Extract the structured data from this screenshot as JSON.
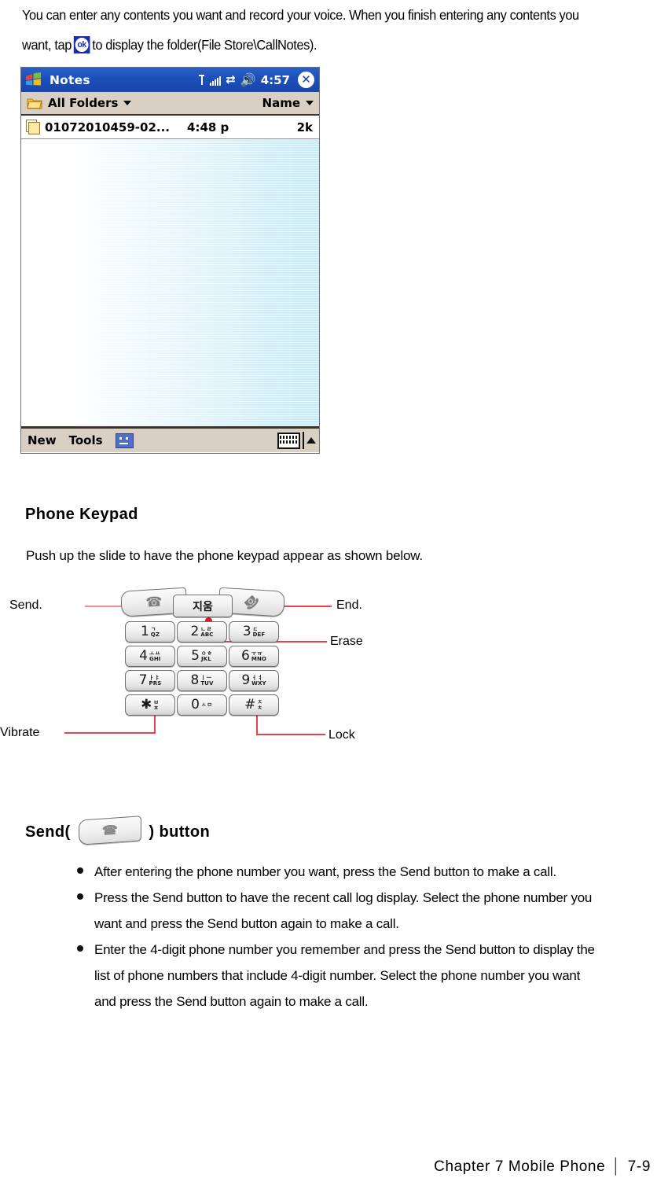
{
  "intro": {
    "line1": "You can enter any contents you want and record your voice. When you finish entering any contents you",
    "line2_before": "want, tap",
    "line2_after": "to display the folder(File Store\\CallNotes).",
    "ok_icon_label": "ok"
  },
  "pda": {
    "app_title": "Notes",
    "clock": "4:57",
    "close_label": "✕",
    "folder_filter": "All Folders",
    "sort_label": "Name",
    "note": {
      "name": "01072010459-02...",
      "time": "4:48 p",
      "size": "2k"
    },
    "bottom": {
      "new_label": "New",
      "tools_label": "Tools"
    }
  },
  "section": {
    "heading": "Phone Keypad",
    "intro": "Push up the slide to have the phone keypad appear as shown below."
  },
  "keypad": {
    "softkeys": {
      "send": "☎",
      "erase": "지움",
      "end": "☎"
    },
    "keys": [
      {
        "num": "1",
        "kr": "ㄱ",
        "en": "QZ"
      },
      {
        "num": "2",
        "kr": "ㄴㄹ",
        "en": "ABC"
      },
      {
        "num": "3",
        "kr": "ㄷ",
        "en": "DEF"
      },
      {
        "num": "4",
        "kr": "ㅗㅛ",
        "en": "GHI"
      },
      {
        "num": "5",
        "kr": "ㅇㅎ",
        "en": "JKL"
      },
      {
        "num": "6",
        "kr": "ㅜㅠ",
        "en": "MNO"
      },
      {
        "num": "7",
        "kr": "ㅏㅑ",
        "en": "PRS"
      },
      {
        "num": "8",
        "kr": "ㅣㅡ",
        "en": "TUV"
      },
      {
        "num": "9",
        "kr": "ㅓㅕ",
        "en": "WXY"
      },
      {
        "num": "✱",
        "kr": "ㅂ",
        "en": "ㅍ"
      },
      {
        "num": "0",
        "kr": "ㅅㅁ",
        "en": ""
      },
      {
        "num": "#",
        "kr": "ㅈ",
        "en": "ㅊ"
      }
    ],
    "callouts": {
      "send": "Send.",
      "end": "End.",
      "erase": "Erase",
      "vibrate": "Vibrate",
      "lock": "Lock"
    }
  },
  "send_button": {
    "heading_before": "Send(",
    "heading_after": ") button",
    "bullets": [
      [
        "After entering the phone number you want, press the Send button to make a call."
      ],
      [
        "Press the Send button to have the recent call log display. Select the phone number you",
        "want and press the Send button again to make a call."
      ],
      [
        "Enter the 4-digit phone number you remember and press the Send button to display the",
        "list of phone numbers that include 4-digit number. Select the phone number you want",
        "and press the Send button again to make a call."
      ]
    ]
  },
  "footer": {
    "chapter": "Chapter 7 Mobile Phone",
    "separator": "│",
    "page": "7-9"
  }
}
